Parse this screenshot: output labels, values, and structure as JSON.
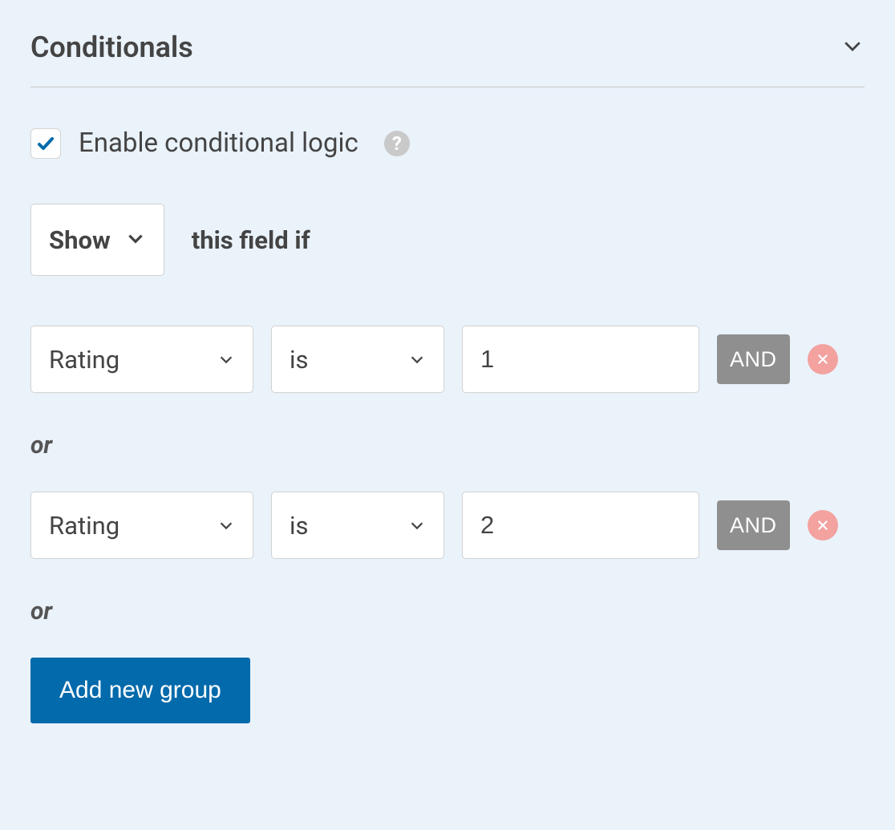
{
  "panel": {
    "title": "Conditionals"
  },
  "enable": {
    "checked": true,
    "label": "Enable conditional logic"
  },
  "action": {
    "selected": "Show",
    "suffix": "this field if"
  },
  "groups": [
    {
      "field": "Rating",
      "operator": "is",
      "value": "1",
      "and_label": "AND"
    },
    {
      "field": "Rating",
      "operator": "is",
      "value": "2",
      "and_label": "AND"
    }
  ],
  "or_label": "or",
  "add_group_label": "Add new group"
}
